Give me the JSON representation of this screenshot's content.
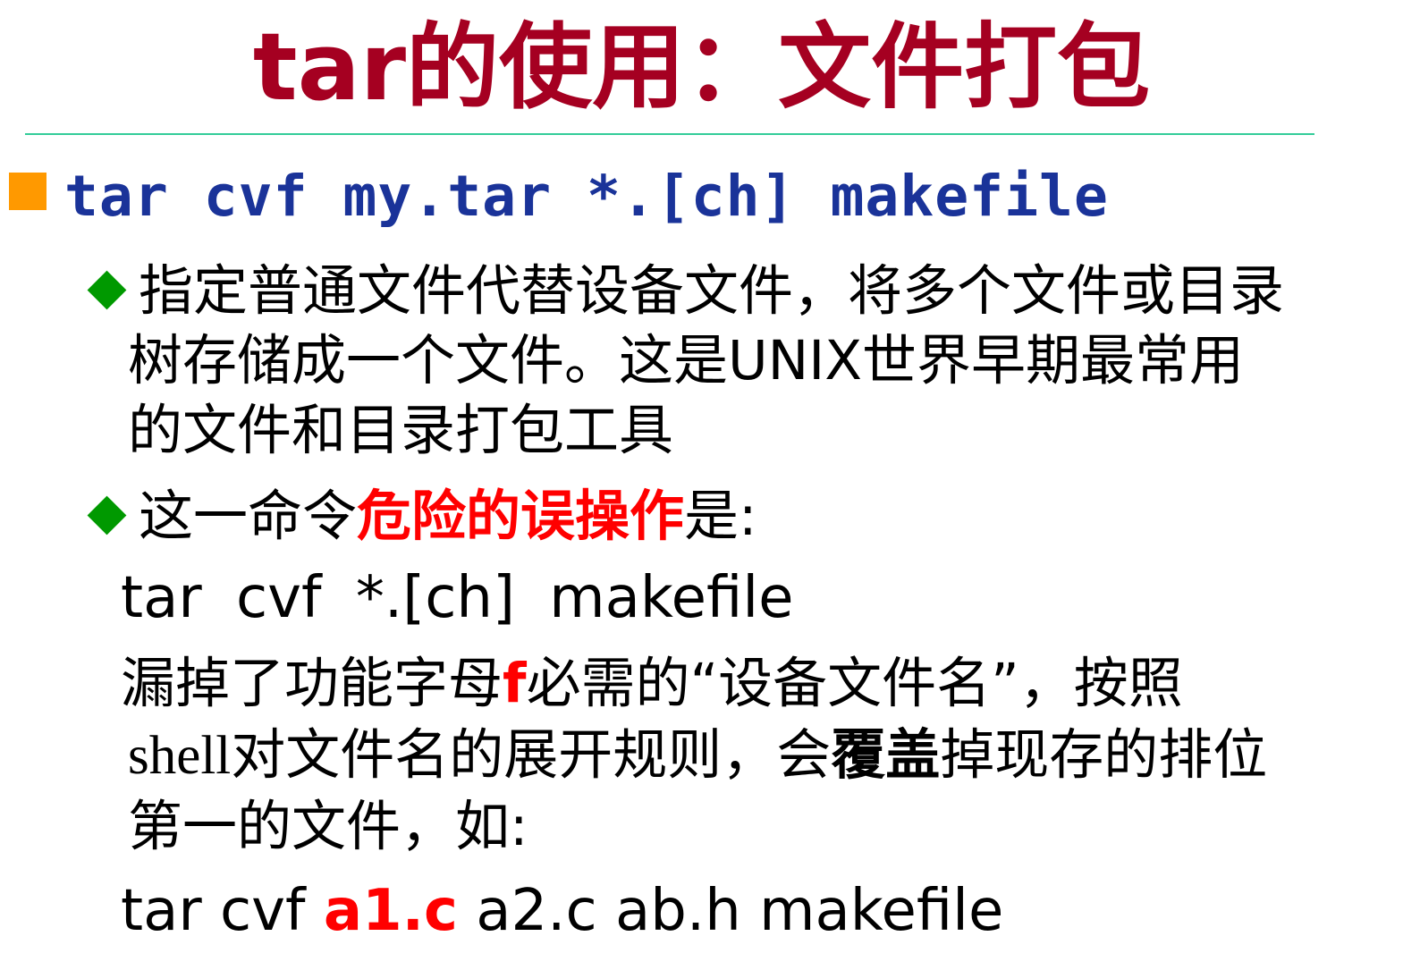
{
  "title": "tar的使用：文件打包",
  "command": "tar cvf my.tar *.[ch] makefile",
  "bullet1": {
    "lines": [
      "指定普通文件代替设备文件，将多个文件或目录",
      "树存储成一个文件。这是UNIX世界早期最常用",
      "的文件和目录打包工具"
    ]
  },
  "bullet2": {
    "prefix": "这一命令",
    "highlight": "危险的误操作",
    "suffix": "是:"
  },
  "wrong_command": "tar cvf *.[ch] makefile",
  "explanation": {
    "line1_pre": "漏掉了功能字母",
    "line1_f": "f",
    "line1_post": "必需的“设备文件名”，按照",
    "line2_shell": "shell",
    "line2_mid": "对文件名的展开规则，会",
    "line2_bold": "覆盖",
    "line2_post": "掉现存的排位",
    "line3": "第一的文件，如:"
  },
  "example": {
    "pre": "tar cvf ",
    "highlight": "a1.c",
    "post": " a2.c ab.h makefile"
  },
  "colors": {
    "title": "#a50021",
    "command": "#1a3399",
    "square_bullet": "#ff9900",
    "diamond_bullet": "#009900",
    "rule": "#33cc99",
    "highlight": "#ff0000"
  },
  "icons": {
    "square": "square-bullet-icon",
    "diamond": "diamond-bullet-icon"
  }
}
